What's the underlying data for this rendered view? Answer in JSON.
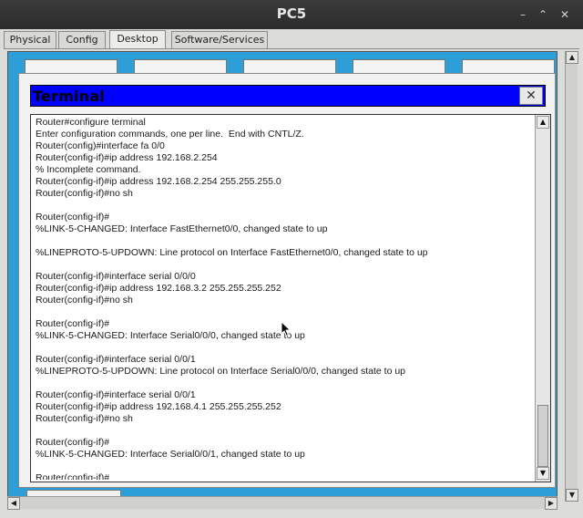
{
  "window": {
    "title": "PC5"
  },
  "tabs": [
    {
      "label": "Physical"
    },
    {
      "label": "Config"
    },
    {
      "label": "Desktop"
    },
    {
      "label": "Software/Services"
    }
  ],
  "terminal": {
    "title": "Terminal",
    "close_label": "✕",
    "lines": [
      "Router#configure terminal",
      "Enter configuration commands, one per line.  End with CNTL/Z.",
      "Router(config)#interface fa 0/0",
      "Router(config-if)#ip address 192.168.2.254",
      "% Incomplete command.",
      "Router(config-if)#ip address 192.168.2.254 255.255.255.0",
      "Router(config-if)#no sh",
      "",
      "Router(config-if)#",
      "%LINK-5-CHANGED: Interface FastEthernet0/0, changed state to up",
      "",
      "%LINEPROTO-5-UPDOWN: Line protocol on Interface FastEthernet0/0, changed state to up",
      "",
      "Router(config-if)#interface serial 0/0/0",
      "Router(config-if)#ip address 192.168.3.2 255.255.255.252",
      "Router(config-if)#no sh",
      "",
      "Router(config-if)#",
      "%LINK-5-CHANGED: Interface Serial0/0/0, changed state to up",
      "",
      "Router(config-if)#interface serial 0/0/1",
      "%LINEPROTO-5-UPDOWN: Line protocol on Interface Serial0/0/0, changed state to up",
      "",
      "Router(config-if)#interface serial 0/0/1",
      "Router(config-if)#ip address 192.168.4.1 255.255.255.252",
      "Router(config-if)#no sh",
      "",
      "Router(config-if)#",
      "%LINK-5-CHANGED: Interface Serial0/0/1, changed state to up",
      "",
      "Router(config-if)#"
    ]
  },
  "icons": {
    "minimize": "minimize-icon",
    "restore": "restore-icon",
    "close": "close-icon"
  },
  "colors": {
    "desktop": "#2e9ed8",
    "terminal_titlebar": "#0000ff"
  }
}
